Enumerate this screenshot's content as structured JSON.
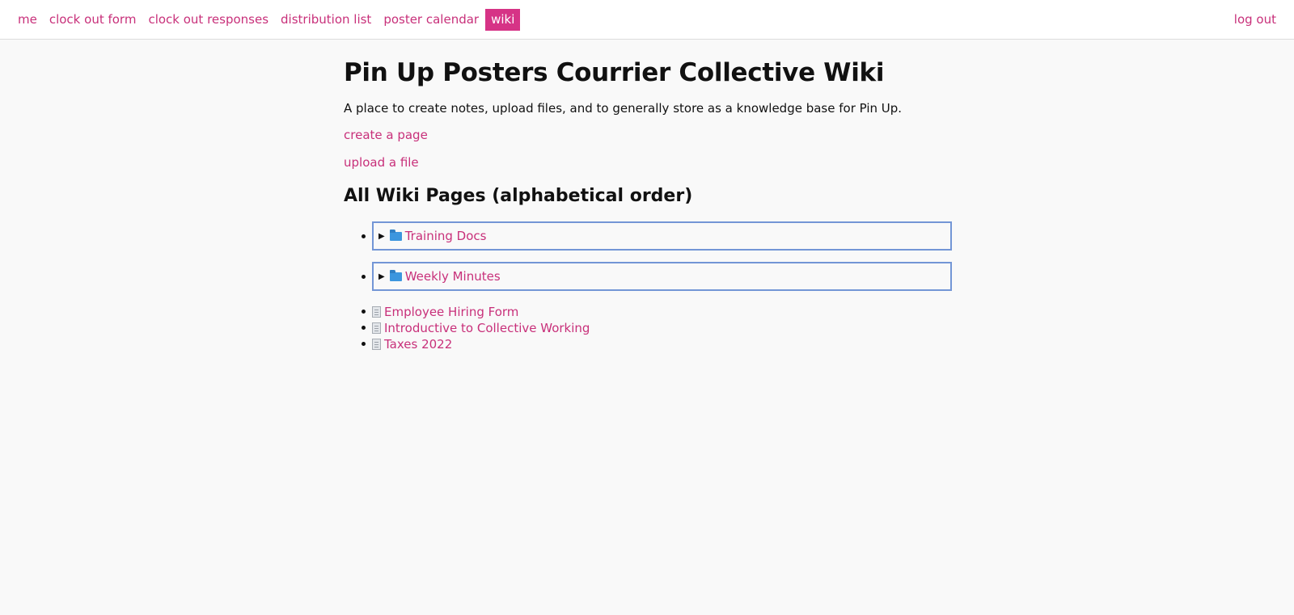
{
  "nav": {
    "items": [
      {
        "label": "me"
      },
      {
        "label": "clock out form"
      },
      {
        "label": "clock out responses"
      },
      {
        "label": "distribution list"
      },
      {
        "label": "poster calendar"
      },
      {
        "label": "wiki",
        "active": true
      }
    ],
    "logout_label": "log out"
  },
  "main": {
    "title": "Pin Up Posters Courrier Collective Wiki",
    "intro": "A place to create notes, upload files, and to generally store as a knowledge base for Pin Up.",
    "create_link": "create a page",
    "upload_link": "upload a file",
    "section_title": "All Wiki Pages (alphabetical order)",
    "folders": [
      {
        "label": "Training Docs",
        "icon": "folder-icon",
        "expanded": false
      },
      {
        "label": "Weekly Minutes",
        "icon": "folder-icon",
        "expanded": false
      }
    ],
    "files": [
      {
        "label": "Employee Hiring Form",
        "icon": "file-icon"
      },
      {
        "label": "Introductive to Collective Working",
        "icon": "file-icon"
      },
      {
        "label": "Taxes 2022",
        "icon": "file-icon"
      }
    ]
  },
  "colors": {
    "accent": "#d63386",
    "link": "#c8307a",
    "folder_border": "#7396d6",
    "background": "#f9f9f9"
  }
}
